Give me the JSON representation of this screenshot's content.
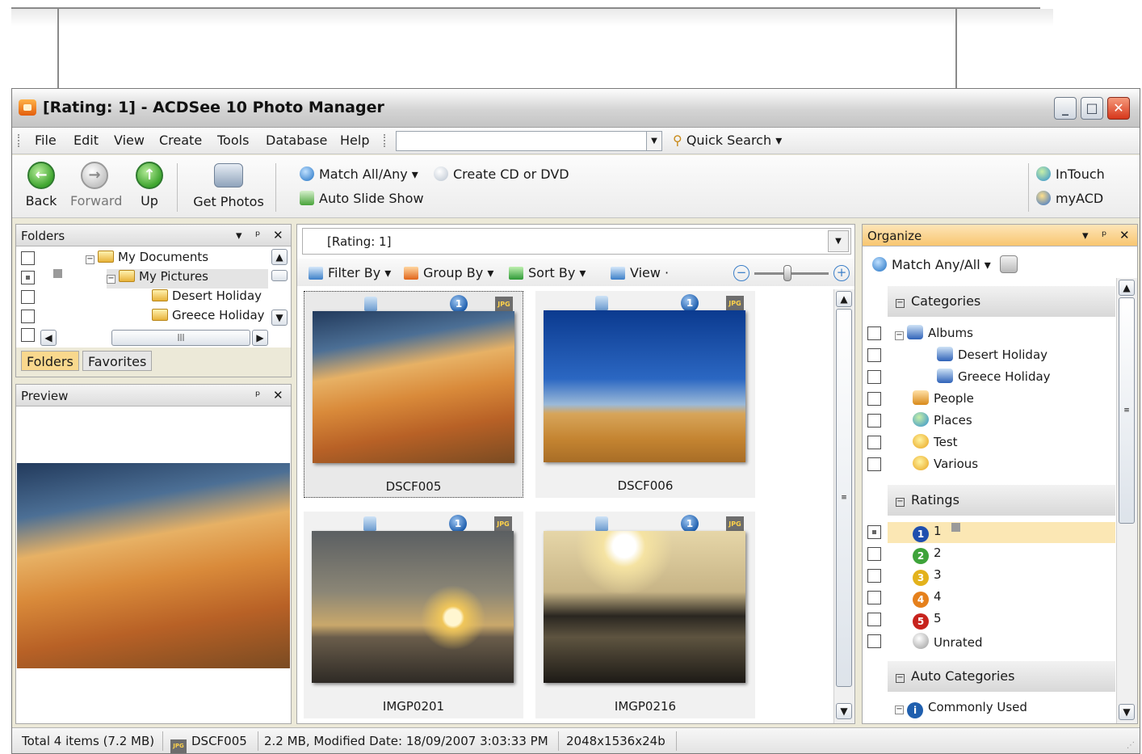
{
  "window": {
    "title": "[Rating: 1] - ACDSee 10 Photo Manager",
    "accent": "#f8c670"
  },
  "menu": {
    "items": [
      "File",
      "Edit",
      "View",
      "Create",
      "Tools",
      "Database",
      "Help"
    ],
    "quick_search": "Quick Search",
    "search_value": ""
  },
  "toolbar": {
    "back": "Back",
    "forward": "Forward",
    "up": "Up",
    "get_photos": "Get Photos",
    "match": "Match All/Any",
    "create_cd": "Create CD or DVD",
    "slideshow": "Auto Slide Show",
    "intouch": "InTouch",
    "myacd": "myACD"
  },
  "folders": {
    "title": "Folders",
    "items": [
      "My Documents",
      "My Pictures",
      "Desert Holiday",
      "Greece Holiday"
    ],
    "tabs": [
      "Folders",
      "Favorites"
    ]
  },
  "preview": {
    "title": "Preview"
  },
  "browser": {
    "address": "[Rating: 1]",
    "filter_by": "Filter By",
    "group_by": "Group By",
    "sort_by": "Sort By",
    "view": "View",
    "thumbnails": [
      {
        "name": "DSCF005",
        "rating": "1",
        "type": "JPG"
      },
      {
        "name": "DSCF006",
        "rating": "1",
        "type": "JPG"
      },
      {
        "name": "IMGP0201",
        "rating": "1",
        "type": "JPG"
      },
      {
        "name": "IMGP0216",
        "rating": "1",
        "type": "JPG"
      }
    ]
  },
  "organize": {
    "title": "Organize",
    "match": "Match Any/All",
    "categories_header": "Categories",
    "categories": [
      "Albums",
      "Desert Holiday",
      "Greece Holiday",
      "People",
      "Places",
      "Test",
      "Various"
    ],
    "ratings_header": "Ratings",
    "ratings": [
      "1",
      "2",
      "3",
      "4",
      "5",
      "Unrated"
    ],
    "auto_header": "Auto Categories",
    "auto_items": [
      "Commonly Used"
    ]
  },
  "status": {
    "total": "Total 4 items  (7.2 MB)",
    "file": "DSCF005",
    "details": "2.2 MB, Modified Date: 18/09/2007 3:03:33 PM",
    "dims": "2048x1536x24b"
  }
}
